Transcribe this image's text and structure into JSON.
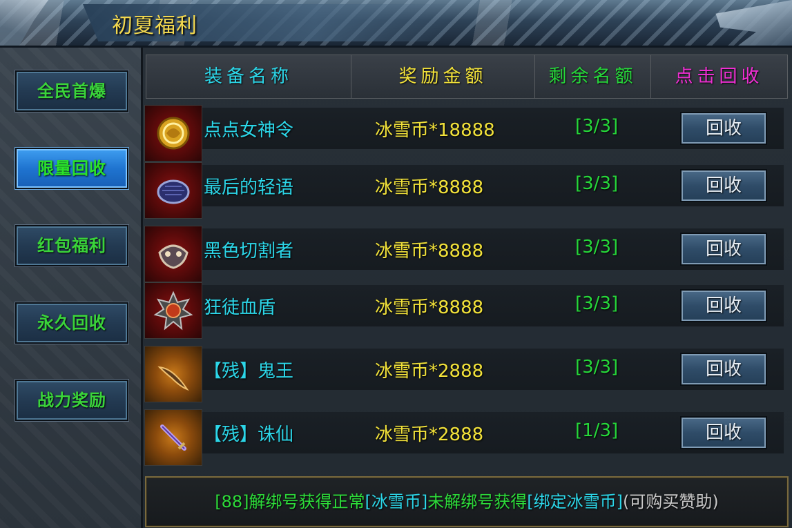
{
  "window": {
    "title": "初夏福利"
  },
  "sidebar": {
    "tabs": [
      {
        "label": "全民首爆",
        "active": false
      },
      {
        "label": "限量回收",
        "active": true
      },
      {
        "label": "红包福利",
        "active": false
      },
      {
        "label": "永久回收",
        "active": false
      },
      {
        "label": "战力奖励",
        "active": false
      }
    ]
  },
  "table": {
    "headers": {
      "name": "装备名称",
      "reward": "奖励金额",
      "remaining": "剩余名额",
      "action": "点击回收"
    },
    "rows": [
      {
        "name": "点点女神令",
        "reward": "冰雪币*18888",
        "remaining": "[3/3]",
        "button": "回收",
        "icon": "golden-dragon-token-icon"
      },
      {
        "name": "最后的轻语",
        "reward": "冰雪币*8888",
        "remaining": "[3/3]",
        "button": "回收",
        "icon": "blue-scale-shield-icon"
      },
      {
        "name": "黑色切割者",
        "reward": "冰雪币*8888",
        "remaining": "[3/3]",
        "button": "回收",
        "icon": "dark-mask-icon"
      },
      {
        "name": "狂徒血盾",
        "reward": "冰雪币*8888",
        "remaining": "[3/3]",
        "button": "回收",
        "icon": "spiked-shield-icon"
      },
      {
        "name": "【残】鬼王",
        "reward": "冰雪币*2888",
        "remaining": "[3/3]",
        "button": "回收",
        "icon": "curved-blade-icon"
      },
      {
        "name": "【残】诛仙",
        "reward": "冰雪币*2888",
        "remaining": "[1/3]",
        "button": "回收",
        "icon": "purple-sword-icon"
      }
    ]
  },
  "footer": {
    "part1": "[88]解绑号获得正常",
    "part2": "[冰雪币]",
    "part3": "未解绑号获得",
    "part4": "[绑定冰雪币]",
    "part5": "(可购买赞助)"
  },
  "colors": {
    "title": "#f3d84e",
    "item_name": "#2cd6e8",
    "reward": "#f2e23a",
    "remaining": "#26d83a",
    "action_header": "#ee2ed2",
    "tab_text": "#3ad43a"
  }
}
